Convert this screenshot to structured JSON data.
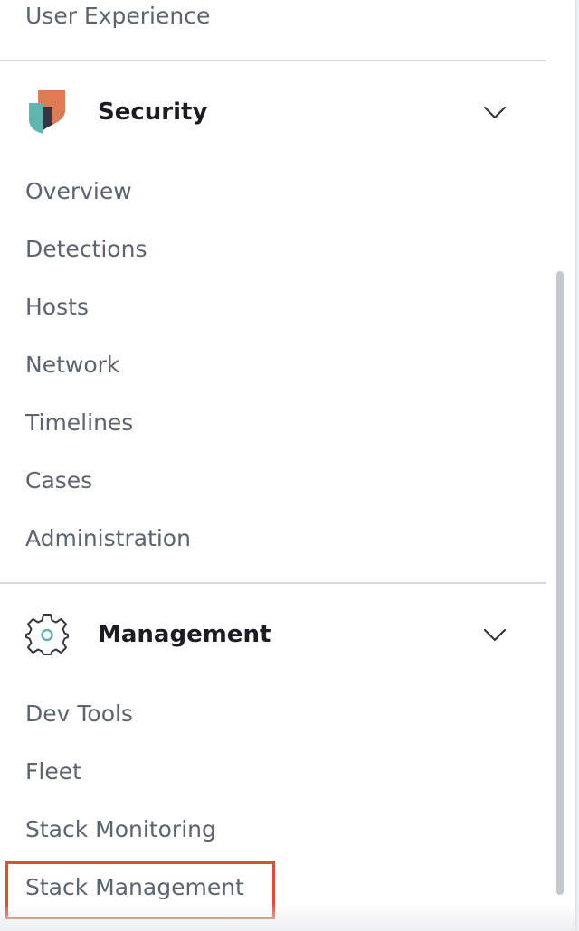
{
  "nav": {
    "top_item": {
      "label": "User Experience"
    },
    "security": {
      "title": "Security",
      "icon": "security-logo-icon",
      "items": [
        {
          "label": "Overview"
        },
        {
          "label": "Detections"
        },
        {
          "label": "Hosts"
        },
        {
          "label": "Network"
        },
        {
          "label": "Timelines"
        },
        {
          "label": "Cases"
        },
        {
          "label": "Administration"
        }
      ]
    },
    "management": {
      "title": "Management",
      "icon": "gear-icon",
      "items": [
        {
          "label": "Dev Tools"
        },
        {
          "label": "Fleet"
        },
        {
          "label": "Stack Monitoring"
        },
        {
          "label": "Stack Management"
        }
      ]
    }
  },
  "colors": {
    "link_text": "#5c6470",
    "heading_text": "#1a1c21",
    "divider": "#d6d9de",
    "highlight": "#d4513a",
    "security_orange": "#e07a55",
    "security_teal": "#5fb6ae",
    "security_dark": "#343741"
  }
}
